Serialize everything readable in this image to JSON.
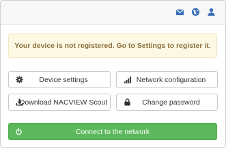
{
  "header": {
    "icons": [
      "envelope-icon",
      "globe-icon",
      "user-icon"
    ]
  },
  "alert": {
    "text": "Your device is not registered. Go to Settings to register it."
  },
  "buttons": {
    "device_settings": "Device settings",
    "network_configuration": "Network configuration",
    "download_scout": "Download NACVIEW Scout",
    "change_password": "Change password",
    "connect": "Connect to the network"
  },
  "colors": {
    "alert_background": "#fcf8e3",
    "alert_text": "#8a6d3b",
    "connect_button": "#5cb85c",
    "header_icons": "#3b6fb6"
  }
}
